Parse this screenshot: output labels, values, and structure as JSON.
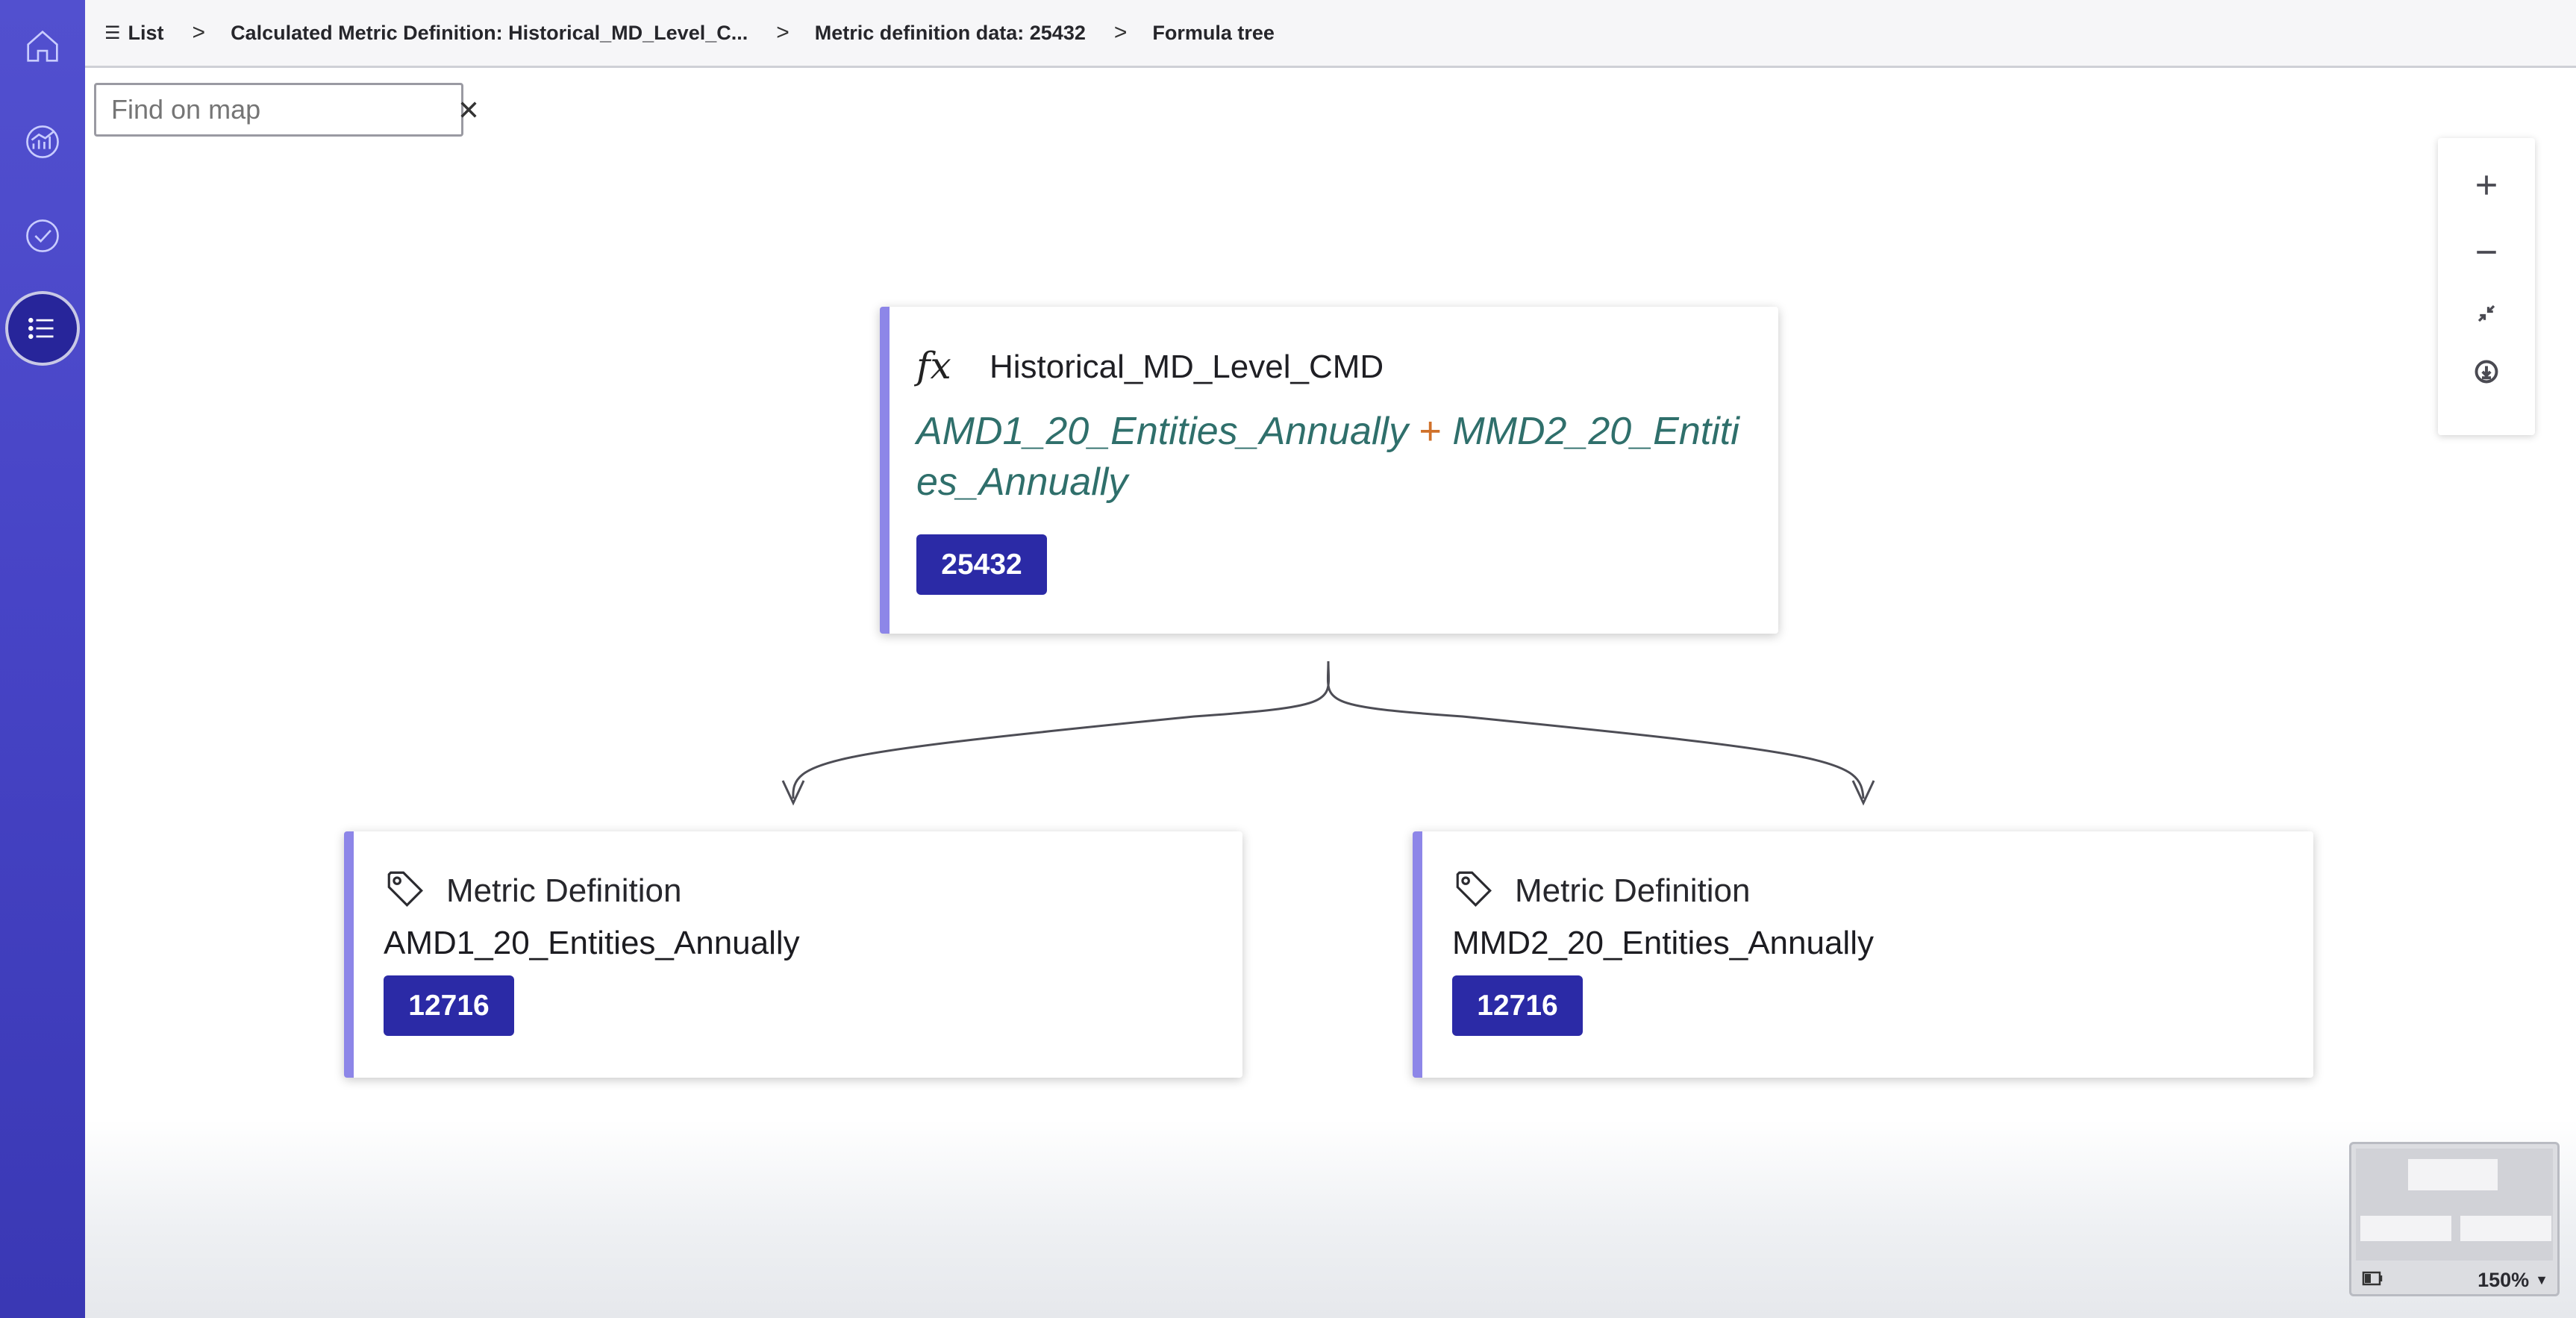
{
  "nav": {
    "items": [
      {
        "icon": "home-icon",
        "label": "Home"
      },
      {
        "icon": "analytics-icon",
        "label": "Analytics"
      },
      {
        "icon": "check-circle-icon",
        "label": "Tasks"
      },
      {
        "icon": "list-icon",
        "label": "List",
        "active": true
      }
    ]
  },
  "breadcrumb": {
    "items": [
      {
        "label": "List",
        "icon": "list-glyph"
      },
      {
        "label": "Calculated Metric Definition: Historical_MD_Level_C..."
      },
      {
        "label": "Metric definition data: 25432"
      },
      {
        "label": "Formula tree"
      }
    ],
    "separator": ">"
  },
  "search": {
    "placeholder": "Find on map",
    "value": ""
  },
  "zoom_controls": {
    "buttons": [
      "zoom-in-icon",
      "zoom-out-icon",
      "fit-to-screen-icon",
      "download-icon"
    ]
  },
  "formula_tree": {
    "root": {
      "icon_glyph": "fx",
      "title": "Historical_MD_Level_CMD",
      "formula": {
        "left": "AMD1_20_Entities_Annually",
        "operator": "+",
        "right": "MMD2_20_Entities_Annually"
      },
      "badge": "25432"
    },
    "children": [
      {
        "type_label": "Metric Definition",
        "name": "AMD1_20_Entities_Annually",
        "badge": "12716"
      },
      {
        "type_label": "Metric Definition",
        "name": "MMD2_20_Entities_Annually",
        "badge": "12716"
      }
    ]
  },
  "minimap": {
    "zoom_level": "150%"
  },
  "colors": {
    "rail": "#4744c6",
    "card_accent": "#8d86e8",
    "badge": "#2b2aa6",
    "formula_text": "#2f6f6b",
    "operator": "#d0712a"
  }
}
